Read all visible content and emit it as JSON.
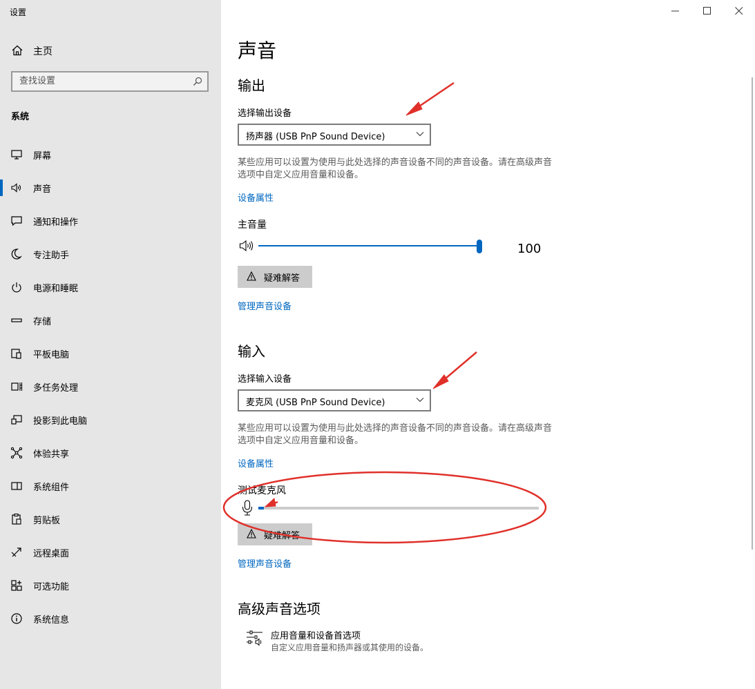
{
  "window": {
    "title": "设置",
    "controls": [
      "minimize-icon",
      "maximize-icon",
      "close-icon"
    ]
  },
  "sidebar": {
    "home_label": "主页",
    "search_placeholder": "查找设置",
    "section_title": "系统",
    "items": [
      {
        "label": "屏幕",
        "icon": "display-icon",
        "selected": false
      },
      {
        "label": "声音",
        "icon": "speaker-icon",
        "selected": true
      },
      {
        "label": "通知和操作",
        "icon": "notification-icon",
        "selected": false
      },
      {
        "label": "专注助手",
        "icon": "moon-icon",
        "selected": false
      },
      {
        "label": "电源和睡眠",
        "icon": "power-icon",
        "selected": false
      },
      {
        "label": "存储",
        "icon": "storage-icon",
        "selected": false
      },
      {
        "label": "平板电脑",
        "icon": "tablet-icon",
        "selected": false
      },
      {
        "label": "多任务处理",
        "icon": "multitasking-icon",
        "selected": false
      },
      {
        "label": "投影到此电脑",
        "icon": "project-icon",
        "selected": false
      },
      {
        "label": "体验共享",
        "icon": "shared-experiences-icon",
        "selected": false
      },
      {
        "label": "系统组件",
        "icon": "system-components-icon",
        "selected": false
      },
      {
        "label": "剪贴板",
        "icon": "clipboard-icon",
        "selected": false
      },
      {
        "label": "远程桌面",
        "icon": "remote-desktop-icon",
        "selected": false
      },
      {
        "label": "可选功能",
        "icon": "optional-features-icon",
        "selected": false
      },
      {
        "label": "系统信息",
        "icon": "info-icon",
        "selected": false
      }
    ]
  },
  "main": {
    "title": "声音",
    "output": {
      "heading": "输出",
      "device_label": "选择输出设备",
      "device_value": "扬声器 (USB PnP Sound Device)",
      "description": "某些应用可以设置为使用与此处选择的声音设备不同的声音设备。请在高级声音选项中自定义应用音量和设备。",
      "properties_link": "设备属性",
      "volume_label": "主音量",
      "volume_value": "100",
      "volume_level": 1.0,
      "troubleshoot_label": "疑难解答",
      "manage_link": "管理声音设备"
    },
    "input": {
      "heading": "输入",
      "device_label": "选择输入设备",
      "device_value": "麦克风 (USB PnP Sound Device)",
      "description": "某些应用可以设置为使用与此处选择的声音设备不同的声音设备。请在高级声音选项中自定义应用音量和设备。",
      "properties_link": "设备属性",
      "test_label": "测试麦克风",
      "mic_level": 0.02,
      "troubleshoot_label": "疑难解答",
      "manage_link": "管理声音设备"
    },
    "advanced": {
      "heading": "高级声音选项",
      "item_title": "应用音量和设备首选项",
      "item_desc": "自定义应用音量和扬声器或其使用的设备。"
    }
  },
  "colors": {
    "accent": "#0067c0",
    "sidebar_bg": "#e6e6e6",
    "annotation": "#e0302a"
  }
}
